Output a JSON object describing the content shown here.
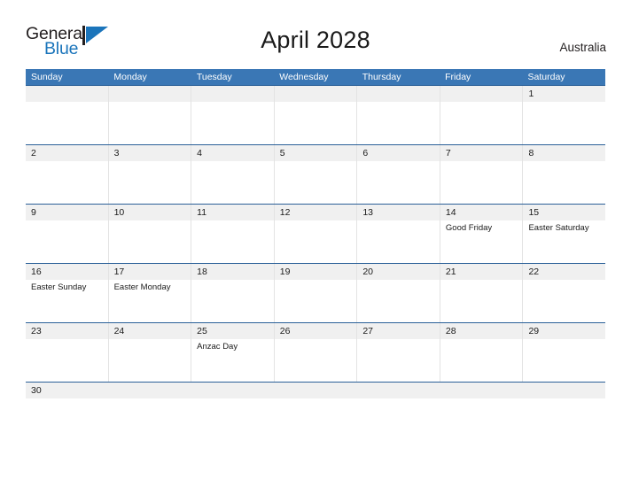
{
  "brand": {
    "name_part1": "General",
    "name_part2": "Blue",
    "mark": "triangle-logo",
    "color_dark": "#231f20",
    "color_blue": "#1b75bb"
  },
  "header": {
    "title": "April 2028",
    "region": "Australia"
  },
  "theme": {
    "header_blue": "#3a77b5",
    "rule_blue": "#2b6098",
    "band_gray": "#f0f0f0",
    "cell_border": "#e3e3e3",
    "text": "#1a1a1a"
  },
  "calendar": {
    "month": "April",
    "year": "2028",
    "weekday_headers": [
      "Sunday",
      "Monday",
      "Tuesday",
      "Wednesday",
      "Thursday",
      "Friday",
      "Saturday"
    ],
    "weeks": [
      [
        {
          "date": "",
          "event": ""
        },
        {
          "date": "",
          "event": ""
        },
        {
          "date": "",
          "event": ""
        },
        {
          "date": "",
          "event": ""
        },
        {
          "date": "",
          "event": ""
        },
        {
          "date": "",
          "event": ""
        },
        {
          "date": "1",
          "event": ""
        }
      ],
      [
        {
          "date": "2",
          "event": ""
        },
        {
          "date": "3",
          "event": ""
        },
        {
          "date": "4",
          "event": ""
        },
        {
          "date": "5",
          "event": ""
        },
        {
          "date": "6",
          "event": ""
        },
        {
          "date": "7",
          "event": ""
        },
        {
          "date": "8",
          "event": ""
        }
      ],
      [
        {
          "date": "9",
          "event": ""
        },
        {
          "date": "10",
          "event": ""
        },
        {
          "date": "11",
          "event": ""
        },
        {
          "date": "12",
          "event": ""
        },
        {
          "date": "13",
          "event": ""
        },
        {
          "date": "14",
          "event": "Good Friday"
        },
        {
          "date": "15",
          "event": "Easter Saturday"
        }
      ],
      [
        {
          "date": "16",
          "event": "Easter Sunday"
        },
        {
          "date": "17",
          "event": "Easter Monday"
        },
        {
          "date": "18",
          "event": ""
        },
        {
          "date": "19",
          "event": ""
        },
        {
          "date": "20",
          "event": ""
        },
        {
          "date": "21",
          "event": ""
        },
        {
          "date": "22",
          "event": ""
        }
      ],
      [
        {
          "date": "23",
          "event": ""
        },
        {
          "date": "24",
          "event": ""
        },
        {
          "date": "25",
          "event": "Anzac Day"
        },
        {
          "date": "26",
          "event": ""
        },
        {
          "date": "27",
          "event": ""
        },
        {
          "date": "28",
          "event": ""
        },
        {
          "date": "29",
          "event": ""
        }
      ],
      [
        {
          "date": "30",
          "event": ""
        },
        {
          "date": "",
          "event": ""
        },
        {
          "date": "",
          "event": ""
        },
        {
          "date": "",
          "event": ""
        },
        {
          "date": "",
          "event": ""
        },
        {
          "date": "",
          "event": ""
        },
        {
          "date": "",
          "event": ""
        }
      ]
    ]
  }
}
